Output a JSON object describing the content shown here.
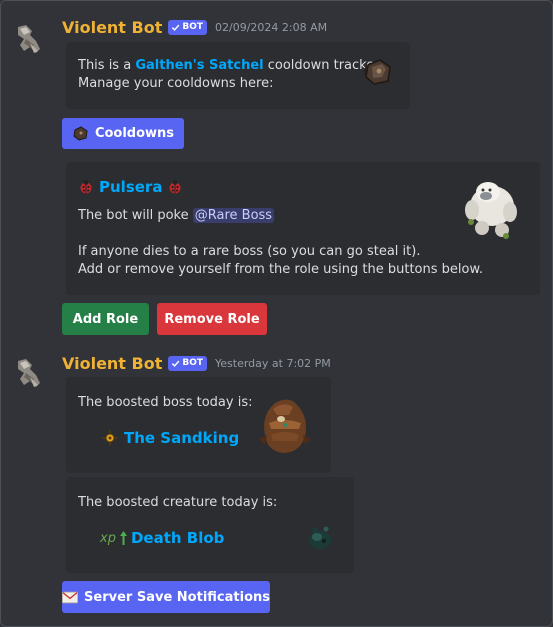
{
  "messages": [
    {
      "username": "Violent Bot",
      "bot_tag": "BOT",
      "timestamp": "02/09/2024 2:08 AM"
    },
    {
      "username": "Violent Bot",
      "bot_tag": "BOT",
      "timestamp": "Yesterday at 7:02 PM"
    }
  ],
  "satchel_embed": {
    "line1_prefix": "This is a ",
    "line1_link": "Galthen's Satchel",
    "line1_suffix": " cooldown tracker.",
    "line2": "Manage your cooldowns here:"
  },
  "cooldowns_button": {
    "label": "Cooldowns"
  },
  "pulsera_embed": {
    "title": "Pulsera",
    "poke_prefix": "The bot will poke ",
    "mention": "@Rare Boss",
    "line3": "If anyone dies to a rare boss (so you can go steal it).",
    "line4": "Add or remove yourself from the role using the buttons below."
  },
  "role_buttons": {
    "add_label": "Add Role",
    "remove_label": "Remove Role"
  },
  "boss_embed": {
    "text": "The boosted boss today is:",
    "name": "The Sandking"
  },
  "creature_embed": {
    "text": "The boosted creature today is:",
    "xp_prefix": "xp",
    "name": "Death Blob"
  },
  "notifications_button": {
    "label": "Server Save Notifications"
  },
  "colors": {
    "background": "#313338",
    "embed": "#2b2d31",
    "username": "#f0b232",
    "link": "#00a8fc",
    "blurple": "#5865f2",
    "green": "#248046",
    "red": "#da373c"
  },
  "icons": [
    "bot-avatar-icon",
    "verified-check-icon",
    "satchel-icon",
    "ladybug-icon",
    "yeti-icon",
    "sandking-icon",
    "sun-icon",
    "death-blob-icon",
    "envelope-icon"
  ]
}
